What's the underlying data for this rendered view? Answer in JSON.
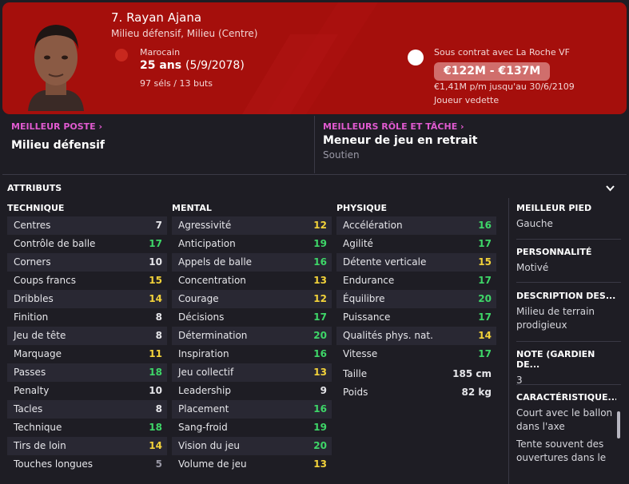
{
  "header": {
    "name": "7. Rayan Ajana",
    "positions": "Milieu défensif, Milieu (Centre)",
    "nationality": "Marocain",
    "age": "25 ans",
    "dob": "(5/9/2078)",
    "caps": "97 séls / 13 buts",
    "contract": "Sous contrat avec La Roche VF",
    "value": "€122M - €137M",
    "wage": "€1,41M p/m jusqu'au 30/6/2109",
    "status": "Joueur vedette",
    "colors": {
      "banner": "#a50f0c",
      "value_pill": "#d06e6c"
    }
  },
  "best_position": {
    "label": "MEILLEUR POSTE ›",
    "value": "Milieu défensif"
  },
  "best_role": {
    "label": "MEILLEURS RÔLE ET TÂCHE ›",
    "value": "Meneur de jeu en retrait",
    "duty": "Soutien"
  },
  "attributes": {
    "title": "ATTRIBUTS",
    "collapse_icon": "chevron-down-icon",
    "technique": {
      "label": "TECHNIQUE",
      "rows": [
        {
          "n": "Centres",
          "v": 7
        },
        {
          "n": "Contrôle de balle",
          "v": 17
        },
        {
          "n": "Corners",
          "v": 10
        },
        {
          "n": "Coups francs",
          "v": 15
        },
        {
          "n": "Dribbles",
          "v": 14
        },
        {
          "n": "Finition",
          "v": 8
        },
        {
          "n": "Jeu de tête",
          "v": 8
        },
        {
          "n": "Marquage",
          "v": 11
        },
        {
          "n": "Passes",
          "v": 18
        },
        {
          "n": "Penalty",
          "v": 10
        },
        {
          "n": "Tacles",
          "v": 8
        },
        {
          "n": "Technique",
          "v": 18
        },
        {
          "n": "Tirs de loin",
          "v": 14
        },
        {
          "n": "Touches longues",
          "v": 5
        }
      ]
    },
    "mental": {
      "label": "MENTAL",
      "rows": [
        {
          "n": "Agressivité",
          "v": 12
        },
        {
          "n": "Anticipation",
          "v": 19
        },
        {
          "n": "Appels de balle",
          "v": 16
        },
        {
          "n": "Concentration",
          "v": 13
        },
        {
          "n": "Courage",
          "v": 12
        },
        {
          "n": "Décisions",
          "v": 17
        },
        {
          "n": "Détermination",
          "v": 20
        },
        {
          "n": "Inspiration",
          "v": 16
        },
        {
          "n": "Jeu collectif",
          "v": 13
        },
        {
          "n": "Leadership",
          "v": 9
        },
        {
          "n": "Placement",
          "v": 16
        },
        {
          "n": "Sang-froid",
          "v": 19
        },
        {
          "n": "Vision du jeu",
          "v": 20
        },
        {
          "n": "Volume de jeu",
          "v": 13
        }
      ]
    },
    "physique": {
      "label": "PHYSIQUE",
      "rows": [
        {
          "n": "Accélération",
          "v": 16
        },
        {
          "n": "Agilité",
          "v": 17
        },
        {
          "n": "Détente verticale",
          "v": 15
        },
        {
          "n": "Endurance",
          "v": 17
        },
        {
          "n": "Équilibre",
          "v": 20
        },
        {
          "n": "Puissance",
          "v": 17
        },
        {
          "n": "Qualités phys. nat.",
          "v": 14
        },
        {
          "n": "Vitesse",
          "v": 17
        }
      ],
      "height_label": "Taille",
      "height": "185 cm",
      "weight_label": "Poids",
      "weight": "82 kg"
    }
  },
  "side": {
    "foot_label": "MEILLEUR PIED",
    "foot": "Gauche",
    "personality_label": "PERSONNALITÉ",
    "personality": "Motivé",
    "desc_label": "DESCRIPTION DES...",
    "desc": "Milieu de terrain prodigieux",
    "gk_label": "NOTE (GARDIEN DE...",
    "gk": "3",
    "traits_label": "CARACTÉRISTIQUE...",
    "trait1": "Court avec le ballon dans l'axe",
    "trait2": "Tente souvent des ouvertures dans le"
  }
}
